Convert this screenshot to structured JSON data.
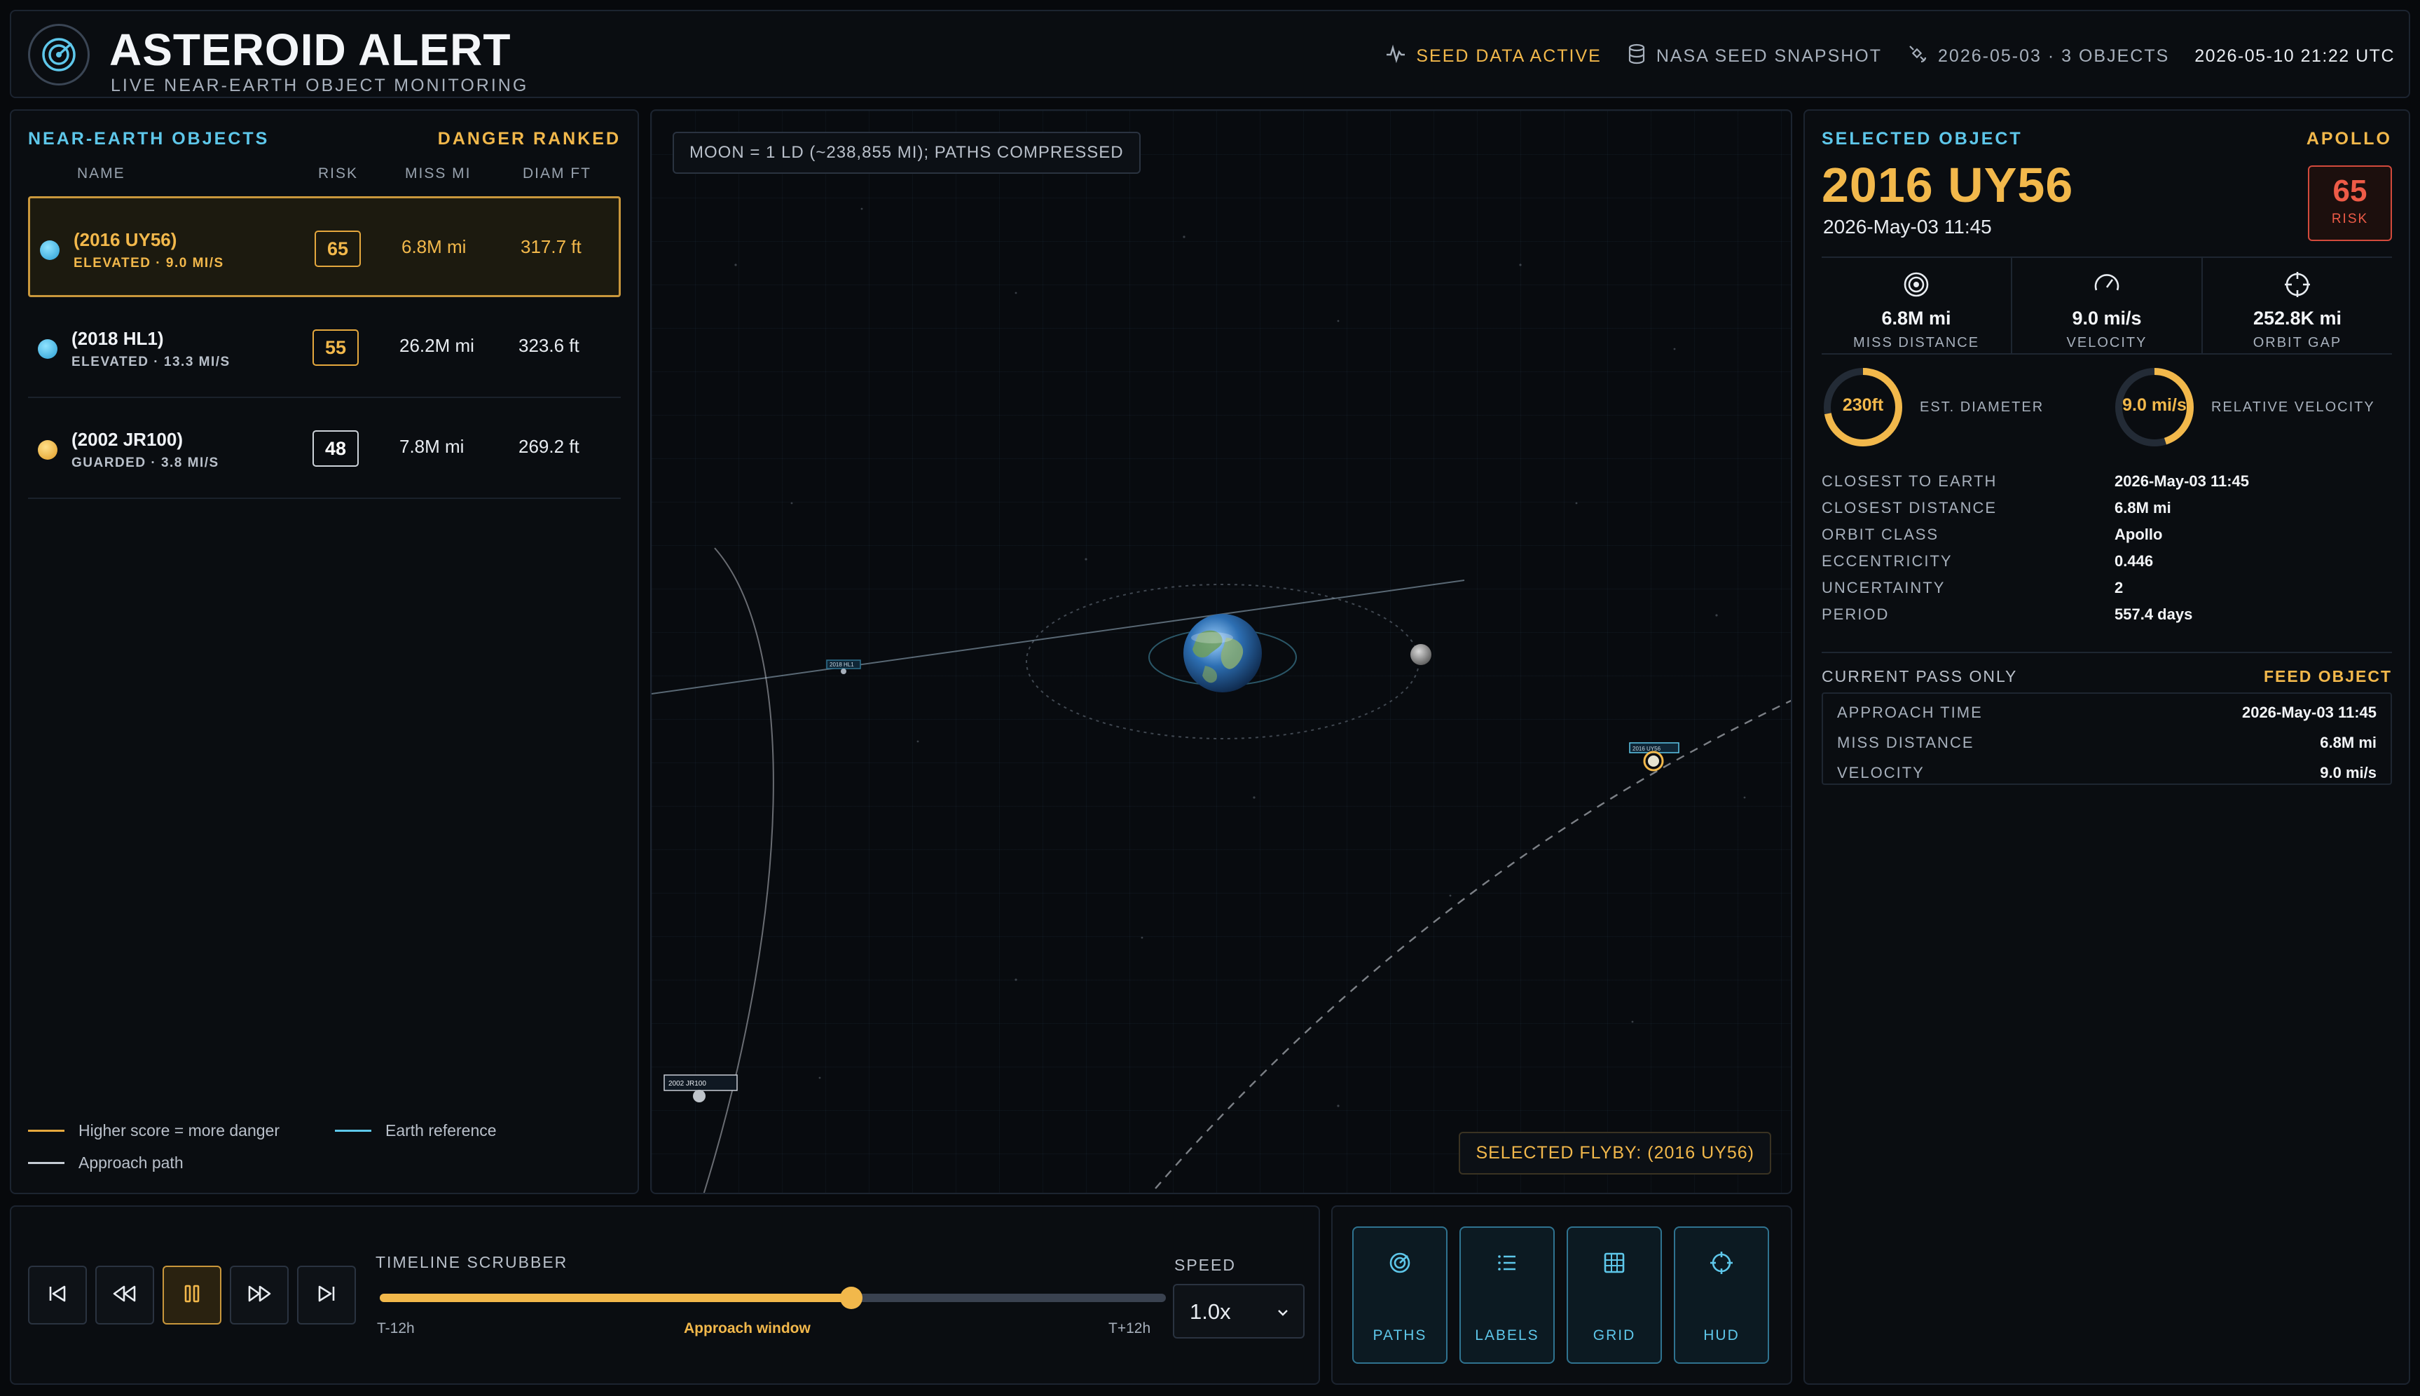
{
  "header": {
    "title": "ASTEROID ALERT",
    "subtitle": "LIVE NEAR-EARTH OBJECT MONITORING",
    "status_seed": "SEED DATA ACTIVE",
    "status_snapshot": "NASA SEED SNAPSHOT",
    "status_feed": "2026-05-03 · 3 OBJECTS",
    "time": "2026-05-10 21:22 UTC"
  },
  "left_panel": {
    "title": "NEAR-EARTH OBJECTS",
    "ranking": "DANGER RANKED",
    "columns": {
      "name": "NAME",
      "risk": "RISK",
      "miss": "MISS MI",
      "diam": "DIAM FT"
    },
    "objects": [
      {
        "name": "(2016 UY56)",
        "sub": "ELEVATED · 9.0 MI/S",
        "risk": "65",
        "miss": "6.8M mi",
        "diam": "317.7 ft"
      },
      {
        "name": "(2018 HL1)",
        "sub": "ELEVATED · 13.3 MI/S",
        "risk": "55",
        "miss": "26.2M mi",
        "diam": "323.6 ft"
      },
      {
        "name": "(2002 JR100)",
        "sub": "GUARDED · 3.8 MI/S",
        "risk": "48",
        "miss": "7.8M mi",
        "diam": "269.2 ft"
      }
    ],
    "legend": {
      "score": "Higher score = more danger",
      "earth": "Earth reference",
      "path": "Approach path"
    }
  },
  "map": {
    "note": "MOON = 1 LD (~238,855 MI); PATHS COMPRESSED",
    "selected": "SELECTED FLYBY: (2016 UY56)",
    "labels": {
      "a": "2016 UY56",
      "b": "2018 HL1",
      "c": "2002 JR100"
    }
  },
  "right_panel": {
    "title": "SELECTED OBJECT",
    "orbit_tag": "APOLLO",
    "name": "2016 UY56",
    "date": "2026-May-03 11:45",
    "risk_value": "65",
    "risk_label": "RISK",
    "stats": [
      {
        "value": "6.8M mi",
        "label": "MISS DISTANCE"
      },
      {
        "value": "9.0 mi/s",
        "label": "VELOCITY"
      },
      {
        "value": "252.8K mi",
        "label": "ORBIT GAP"
      }
    ],
    "gauges": [
      {
        "value": "230ft",
        "label": "EST. DIAMETER",
        "level": 0.72
      },
      {
        "value": "9.0 mi/s",
        "label": "RELATIVE VELOCITY",
        "level": 0.45
      }
    ],
    "details": [
      {
        "k": "CLOSEST TO EARTH",
        "v": "2026-May-03 11:45"
      },
      {
        "k": "CLOSEST DISTANCE",
        "v": "6.8M mi"
      },
      {
        "k": "ORBIT CLASS",
        "v": "Apollo"
      },
      {
        "k": "ECCENTRICITY",
        "v": "0.446"
      },
      {
        "k": "UNCERTAINTY",
        "v": "2"
      },
      {
        "k": "PERIOD",
        "v": "557.4 days"
      }
    ],
    "current_pass": {
      "title": "CURRENT PASS ONLY",
      "tag": "FEED OBJECT",
      "rows": [
        {
          "k": "APPROACH TIME",
          "v": "2026-May-03 11:45"
        },
        {
          "k": "MISS DISTANCE",
          "v": "6.8M mi"
        },
        {
          "k": "VELOCITY",
          "v": "9.0 mi/s"
        }
      ]
    }
  },
  "timeline": {
    "label": "TIMELINE SCRUBBER",
    "min": "T-12h",
    "mid": "Approach window",
    "max": "T+12h",
    "position": 0.6,
    "speed_label": "SPEED",
    "speed_value": "1.0x"
  },
  "toggles": {
    "paths": "PATHS",
    "labels": "LABELS",
    "grid": "GRID",
    "hud": "HUD"
  },
  "colors": {
    "accent": "#f2b84b",
    "cyan": "#5ec7ea",
    "danger": "#ee5b47"
  }
}
